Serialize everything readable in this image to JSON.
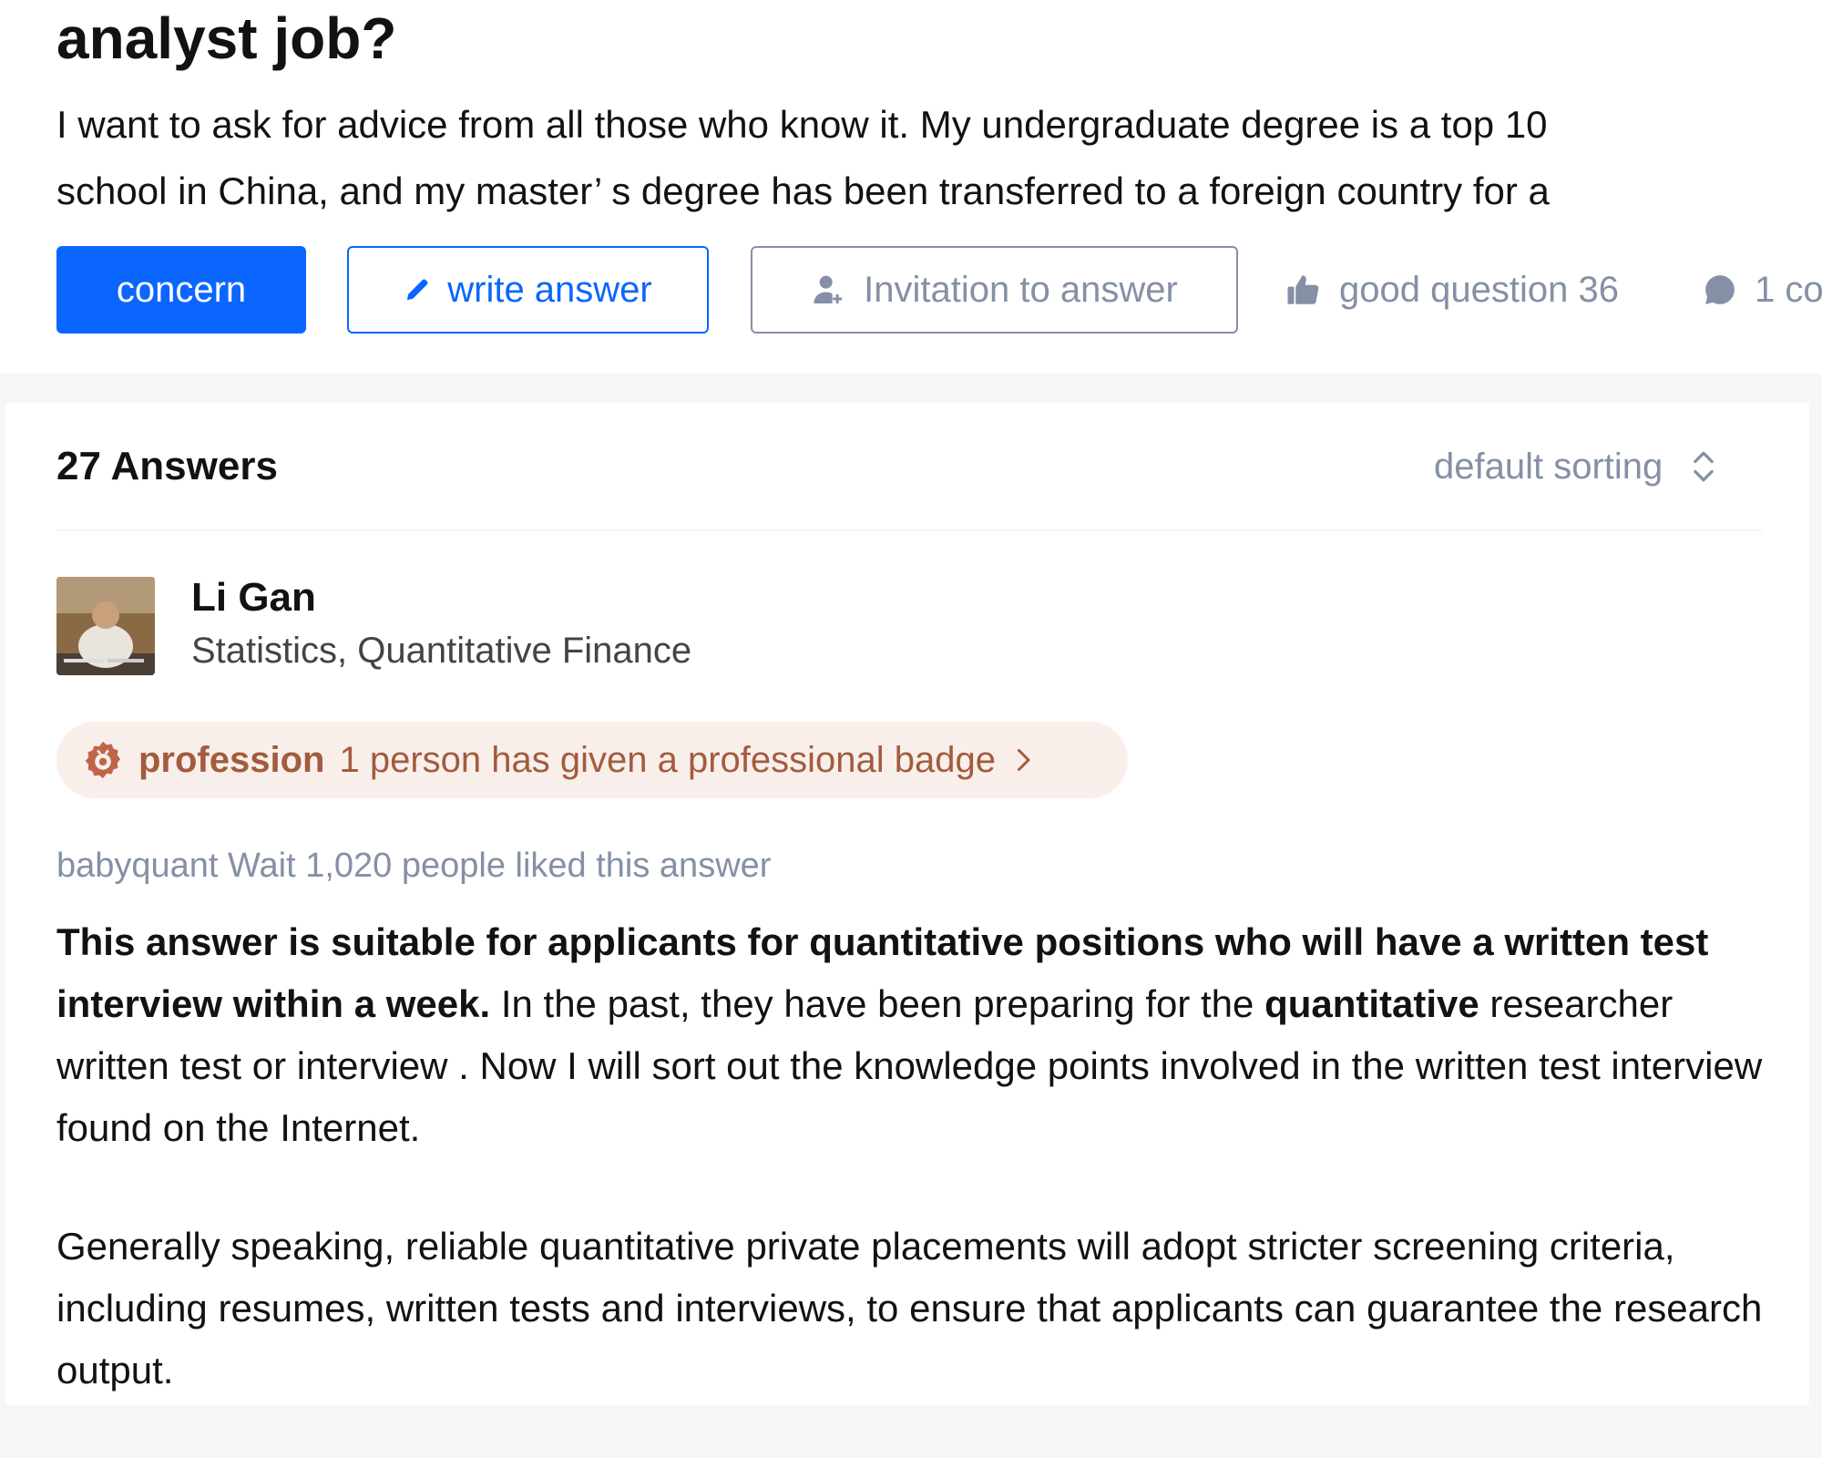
{
  "question": {
    "title": "analyst job?",
    "excerpt_line1": "I want to ask for advice from all those who know it. My undergraduate degree is a top 10",
    "excerpt_line2": "school in China, and my master’ s degree has been transferred to a foreign country for a"
  },
  "actions": {
    "concern_label": "concern",
    "write_answer_label": "write answer",
    "invite_label": "Invitation to answer",
    "good_question_label": "good question 36",
    "comment_label": "1 co"
  },
  "answers": {
    "count_label": "27 Answers",
    "sort_label": "default sorting"
  },
  "answer": {
    "author_name": "Li Gan",
    "author_bio": "Statistics, Quantitative Finance",
    "badge_strong": "profession",
    "badge_text": "1 person has given a professional badge",
    "liked_text": "babyquant Wait 1,020 people liked this answer",
    "p1_bold1": "This answer is suitable for applicants for quantitative positions who will have a written test interview within a week.",
    "p1_text1": " In the past, they have been preparing for the ",
    "p1_bold2": "quantitative",
    "p1_text2": " researcher written test or interview . Now I will sort out the knowledge points involved in the written test interview found on the Internet.",
    "p2": "Generally speaking, reliable quantitative private placements will adopt stricter screening criteria, including resumes, written tests and interviews, to ensure that applicants can guarantee the research output."
  },
  "icons": {
    "write": "pencil-icon",
    "invite": "person-add-icon",
    "good": "thumbs-up-icon",
    "comment": "comment-bubble-icon",
    "sort": "sort-icon",
    "badge": "gear-badge-icon",
    "chevron": "chevron-right-icon"
  },
  "colors": {
    "primary": "#0a66ff",
    "muted": "#8590a6",
    "badge_bg": "#f8efeb",
    "badge_fg": "#a35b3e"
  }
}
